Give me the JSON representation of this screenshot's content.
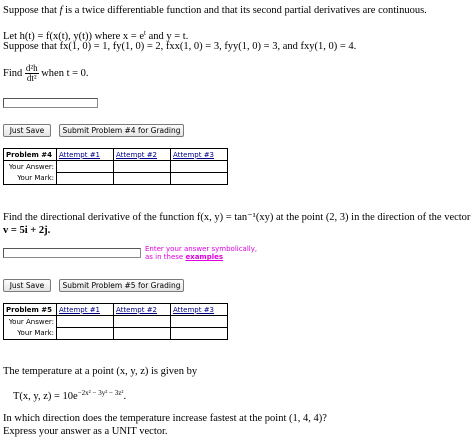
{
  "problem4": {
    "intro_a": "Suppose that ",
    "intro_f": "f",
    "intro_b": " is a twice differentiable function and that its second partial derivatives are continuous.",
    "let_line": "Let h(t) = f(x(t), y(t))  where  x = e",
    "let_exp": "t",
    "let_tail": "  and  y = t.",
    "suppose_line": "Suppose that f",
    "given_values": "x(1, 0) = 1, fy(1, 0) = 2, fxx(1, 0) = 3, fyy(1, 0) = 3,  and  fxy(1, 0) = 4.",
    "find_label": "Find",
    "frac_num": "d²h",
    "frac_den": "dt²",
    "find_tail": "when t = 0.",
    "answer_value": "",
    "save_label": "Just Save",
    "submit_label": "Submit Problem #4 for Grading",
    "table": {
      "header": "Problem #4",
      "attempts": [
        "Attempt #1",
        "Attempt #2",
        "Attempt #3"
      ],
      "answer_label": "Your Answer:",
      "mark_label": "Your Mark:"
    }
  },
  "problem5": {
    "question": "Find the directional derivative of the function f(x, y) = tan⁻¹(xy)  at the point (2, 3) in the direction of the vector",
    "vector_line": "v = 5i + 2j.",
    "answer_value": "",
    "hint_line1": "Enter your answer symbolically,",
    "hint_line2": "as in these ",
    "hint_link": "examples",
    "save_label": "Just Save",
    "submit_label": "Submit Problem #5 for Grading",
    "table": {
      "header": "Problem #5",
      "attempts": [
        "Attempt #1",
        "Attempt #2",
        "Attempt #3"
      ],
      "answer_label": "Your Answer:",
      "mark_label": "Your Mark:"
    }
  },
  "problem6": {
    "intro": "The temperature at a point (x, y, z) is given by",
    "formula_lhs": "T(x, y, z) = 10e",
    "formula_exp": "−2x² − 3y² − 3z²",
    "formula_end": ".",
    "question": "In which direction does the temperature increase fastest at the point (1, 4, 4)?",
    "instruction": "Express your answer as a UNIT vector."
  }
}
